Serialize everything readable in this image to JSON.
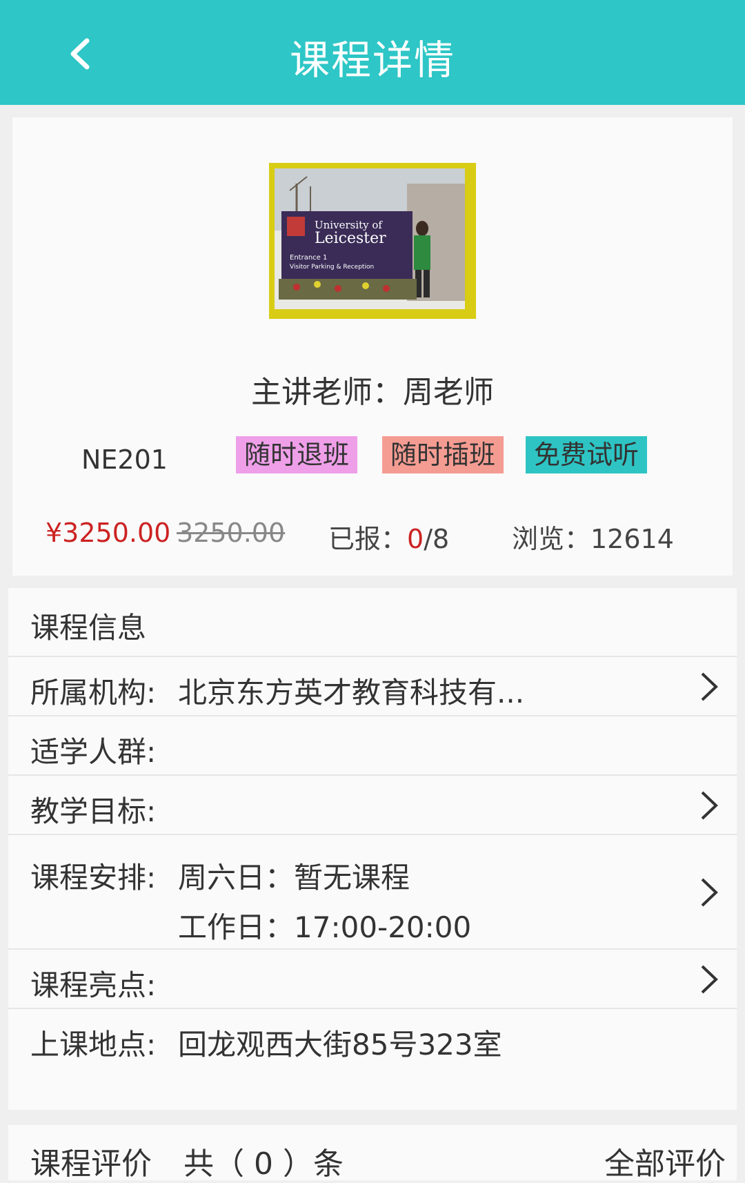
{
  "header": {
    "title": "课程详情",
    "background": "#2ec6c6",
    "back_icon": "chevron-left-icon"
  },
  "course": {
    "image_sign": {
      "line1": "University of",
      "line2": "Leicester",
      "line3": "Entrance 1",
      "line4": "Visitor Parking & Reception"
    },
    "teacher": "主讲老师：周老师",
    "code": "NE201",
    "tags": [
      {
        "label": "随时退班",
        "color": "#ee9fe8"
      },
      {
        "label": "随时插班",
        "color": "#f59c92"
      },
      {
        "label": "免费试听",
        "color": "#2ec4c4"
      }
    ],
    "price": "¥3250.00",
    "original_price": "3250.00",
    "enrolled_label": "已报：",
    "enrolled_count": "0",
    "enrolled_total": "/8",
    "views": "浏览：12614"
  },
  "info": {
    "section_title": "课程信息",
    "rows": [
      {
        "label": "所属机构:",
        "value": "北京东方英才教育科技有..."
      },
      {
        "label": "适学人群:",
        "value": ""
      },
      {
        "label": "教学目标:",
        "value": ""
      },
      {
        "label": "课程安排:",
        "value": "周六日：暂无课程",
        "value2": "工作日：17:00-20:00"
      },
      {
        "label": "课程亮点:",
        "value": ""
      },
      {
        "label": "上课地点:",
        "value": "回龙观西大街85号323室"
      }
    ]
  },
  "review": {
    "label": "课程评价",
    "count_text": "共（ 0 ）条",
    "all_label": "全部评价"
  }
}
